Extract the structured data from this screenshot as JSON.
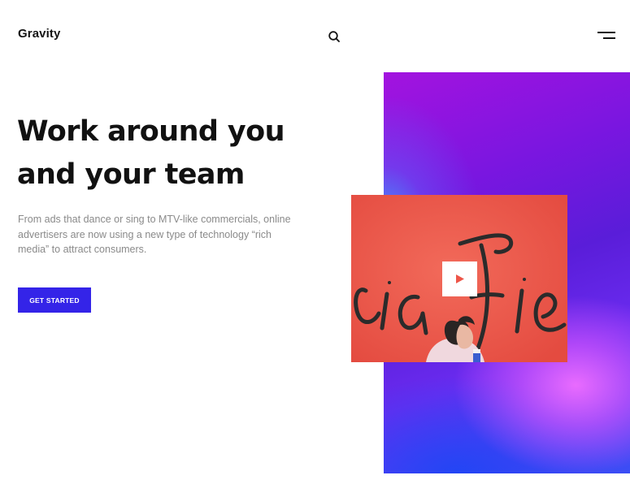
{
  "header": {
    "logo": "Gravity",
    "search_icon": "search-icon",
    "menu_icon": "menu-icon"
  },
  "hero": {
    "title_line1": "Work around you",
    "title_line2": "and your team",
    "description": "From ads that dance or sing to MTV-like commercials, online advertisers are now using a new type of technology “rich media” to attract consumers.",
    "cta_label": "GET STARTED"
  },
  "media": {
    "play_icon": "play-icon"
  },
  "colors": {
    "accent": "#3424e8",
    "title": "#111111",
    "body_text": "#8a8a8a",
    "video_bg": "#ee5548",
    "gradient_start": "#a313df",
    "gradient_end": "#3a4ef5"
  }
}
